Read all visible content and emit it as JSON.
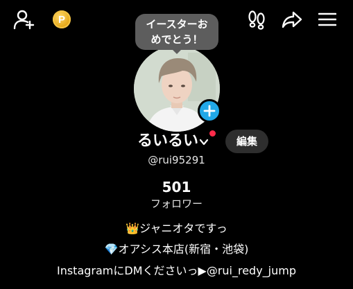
{
  "header": {
    "coin_label": "P",
    "speech_bubble": "イースターお\nめでとう！"
  },
  "profile": {
    "name": "るいるい",
    "handle": "@rui95291",
    "edit_label": "編集",
    "followers_count": "501",
    "followers_label": "フォロワー"
  },
  "bio": {
    "line1": "👑ジャニオタですっ",
    "line2": "💎オアシス本店(新宿・池袋)",
    "line3": "InstagramにDMくださいっ▶@rui_redy_jump"
  },
  "colors": {
    "background": "#000000",
    "plus_button": "#21a8e8",
    "notification_dot": "#ff2b4a",
    "coin": "#e3a412"
  }
}
